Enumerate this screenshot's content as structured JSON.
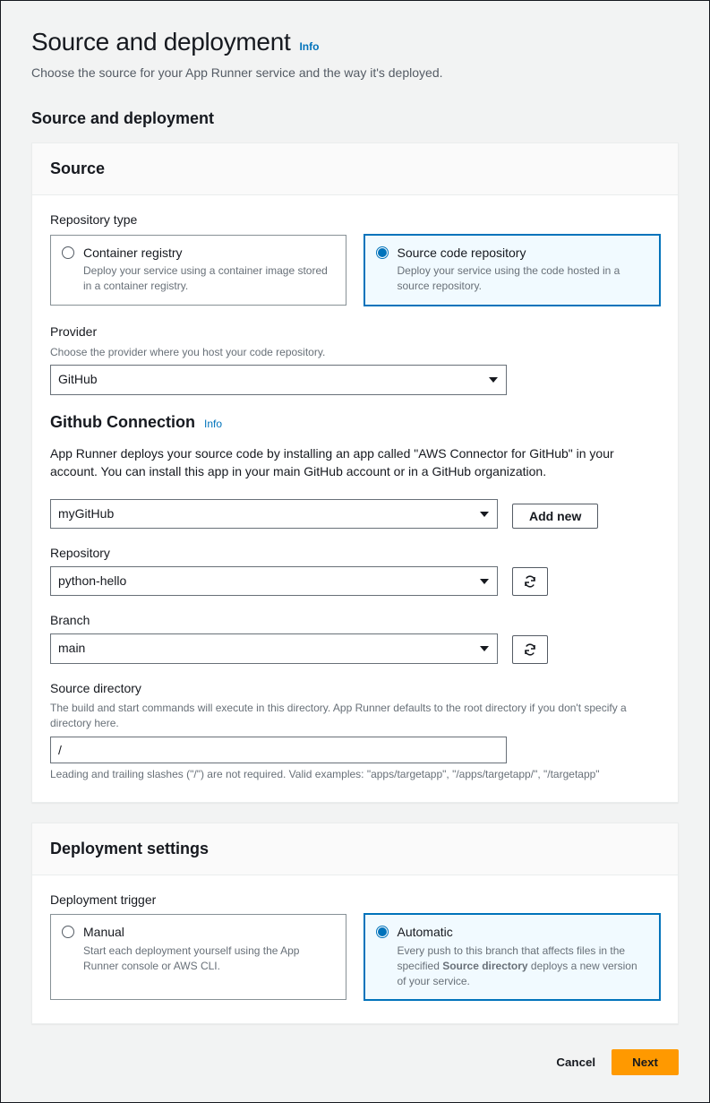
{
  "page": {
    "title": "Source and deployment",
    "info": "Info",
    "description": "Choose the source for your App Runner service and the way it's deployed.",
    "section_heading": "Source and deployment"
  },
  "source": {
    "panel_title": "Source",
    "repo_type_label": "Repository type",
    "options": {
      "container": {
        "title": "Container registry",
        "desc": "Deploy your service using a container image stored in a container registry."
      },
      "code": {
        "title": "Source code repository",
        "desc": "Deploy your service using the code hosted in a source repository."
      }
    },
    "provider_label": "Provider",
    "provider_help": "Choose the provider where you host your code repository.",
    "provider_value": "GitHub",
    "connection": {
      "heading": "Github Connection",
      "info": "Info",
      "desc": "App Runner deploys your source code by installing an app called \"AWS Connector for GitHub\" in your account. You can install this app in your main GitHub account or in a GitHub organization.",
      "value": "myGitHub",
      "add_new": "Add new"
    },
    "repository_label": "Repository",
    "repository_value": "python-hello",
    "branch_label": "Branch",
    "branch_value": "main",
    "source_dir_label": "Source directory",
    "source_dir_help": "The build and start commands will execute in this directory. App Runner defaults to the root directory if you don't specify a directory here.",
    "source_dir_value": "/",
    "source_dir_hint": "Leading and trailing slashes (\"/\") are not required. Valid examples: \"apps/targetapp\", \"/apps/targetapp/\", \"/targetapp\""
  },
  "deployment": {
    "panel_title": "Deployment settings",
    "trigger_label": "Deployment trigger",
    "manual": {
      "title": "Manual",
      "desc": "Start each deployment yourself using the App Runner console or AWS CLI."
    },
    "automatic": {
      "title": "Automatic",
      "desc_pre": "Every push to this branch that affects files in the specified ",
      "desc_strong": "Source directory",
      "desc_post": " deploys a new version of your service."
    }
  },
  "footer": {
    "cancel": "Cancel",
    "next": "Next"
  }
}
